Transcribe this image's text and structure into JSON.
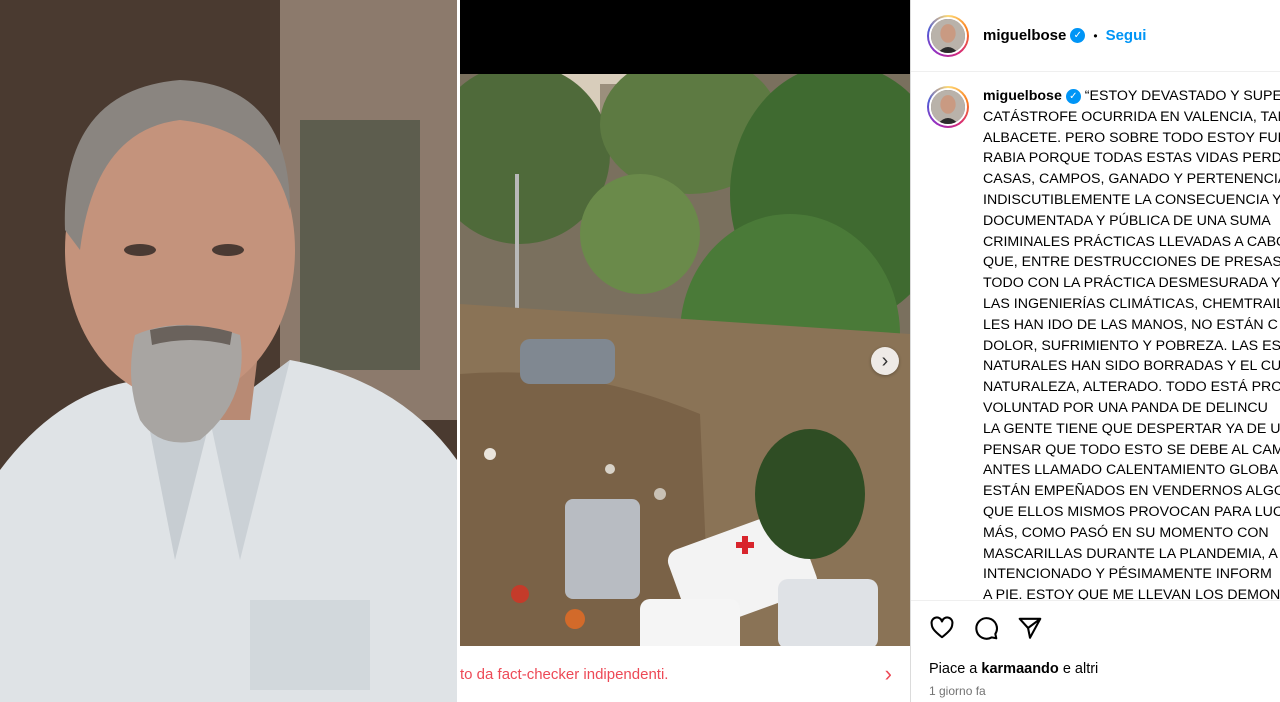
{
  "post": {
    "username": "miguelbose",
    "follow_label": "Segui",
    "separator": "•",
    "caption_lines": [
      "“ESTOY DEVASTADO Y SUPE",
      "CATÁSTROFE OCURRIDA EN VALENCIA, TAM",
      "ALBACETE. PERO SOBRE TODO ESTOY FURI",
      "RABIA PORQUE TODAS ESTAS VIDAS PERD",
      "CASAS, CAMPOS, GANADO Y PERTENENCIA",
      "INDISCUTIBLEMENTE LA CONSECUENCIA Y",
      "DOCUMENTADA Y PÚBLICA DE UNA SUMA",
      "CRIMINALES PRÁCTICAS LLEVADAS A CABO",
      "QUE, ENTRE DESTRUCCIONES DE PRESAS Y",
      "TODO CON LA PRÁCTICA DESMESURADA Y",
      "LAS INGENIERÍAS CLIMÁTICAS, CHEMTRAIL",
      "LES HAN IDO DE LAS MANOS, NO ESTÁN C",
      "DOLOR, SUFRIMIENTO Y POBREZA. LAS ES",
      "NATURALES HAN SIDO BORRADAS Y EL CU",
      "NATURALEZA, ALTERADO. TODO ESTÁ PRO",
      "VOLUNTAD POR UNA PANDA DE DELINCU",
      "LA GENTE TIENE QUE DESPERTAR YA DE UN",
      "PENSAR QUE TODO ESTO SE DEBE AL CAM",
      "ANTES LLAMADO CALENTAMIENTO GLOBA",
      "ESTÁN EMPEÑADOS EN VENDERNOS ALGO",
      "QUE ELLOS MISMOS PROVOCAN PARA LUC",
      "MÁS, COMO PASÓ EN SU MOMENTO CON",
      "MASCARILLAS DURANTE LA PLANDEMIA, A",
      "INTENCIONADO Y PÉSIMAMENTE INFORM",
      "A PIE. ESTOY QUE ME LLEVAN LOS DEMON"
    ],
    "liked_prefix": "Piace a",
    "liked_by": "karmaando",
    "liked_suffix": "e altri",
    "timestamp": "1 giorno fa",
    "factcheck_text": "to da fact-checker indipendenti."
  },
  "icons": {
    "verified": "verified-badge-icon",
    "like": "heart-icon",
    "comment": "comment-icon",
    "share": "share-icon",
    "next": "chevron-right-icon",
    "factcheck_more": "chevron-right-icon"
  },
  "colors": {
    "link_blue": "#0095f6",
    "warning_red": "#ed4956",
    "secondary_text": "#737373"
  }
}
